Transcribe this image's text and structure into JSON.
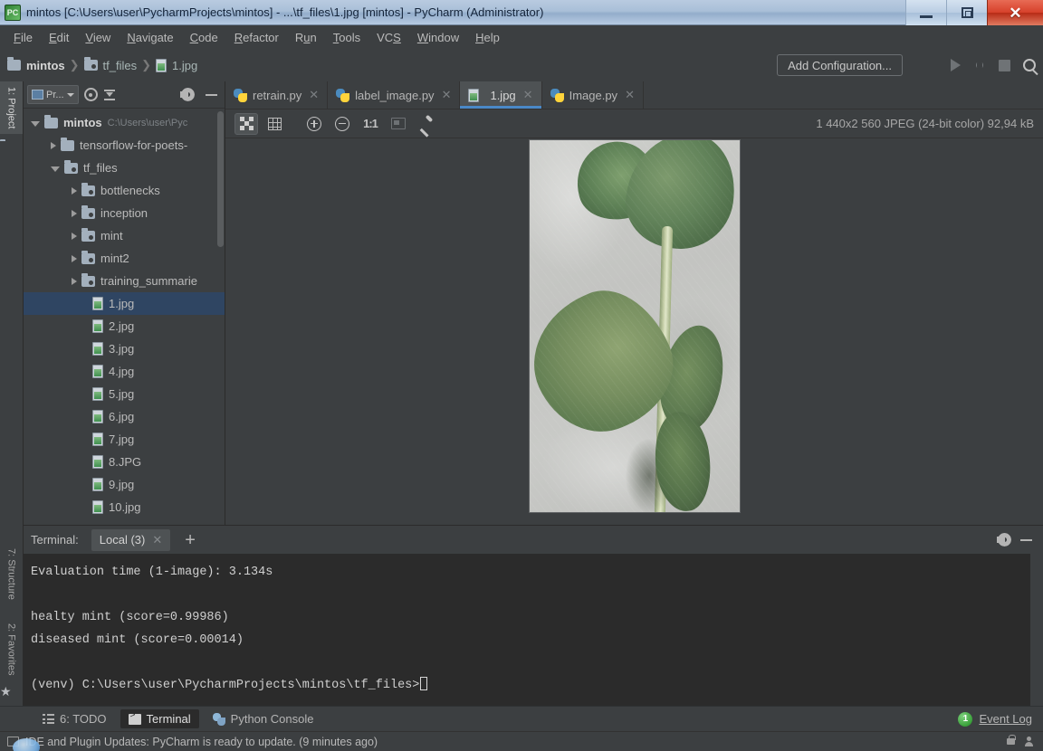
{
  "window": {
    "title": "mintos [C:\\Users\\user\\PycharmProjects\\mintos] - ...\\tf_files\\1.jpg [mintos] - PyCharm (Administrator)",
    "app_icon": "pycharm-icon",
    "controls": {
      "minimize": "minimize-icon",
      "maximize": "restore-icon",
      "close": "✕"
    }
  },
  "menubar": {
    "items": [
      {
        "label": "File"
      },
      {
        "label": "Edit"
      },
      {
        "label": "View"
      },
      {
        "label": "Navigate"
      },
      {
        "label": "Code"
      },
      {
        "label": "Refactor"
      },
      {
        "label": "Run"
      },
      {
        "label": "Tools"
      },
      {
        "label": "VCS"
      },
      {
        "label": "Window"
      },
      {
        "label": "Help"
      }
    ]
  },
  "navbar": {
    "breadcrumbs": [
      {
        "label": "mintos",
        "icon": "folder-icon"
      },
      {
        "label": "tf_files",
        "icon": "source-folder-icon"
      },
      {
        "label": "1.jpg",
        "icon": "jpg-file-icon"
      }
    ],
    "separator": "❯",
    "add_configuration": "Add Configuration...",
    "run_icon": "run-icon",
    "debug_icon": "debug-icon",
    "stop_icon": "stop-icon",
    "search_icon": "search-icon"
  },
  "stripe": {
    "top": [
      {
        "label": "1: Project",
        "icon": "project-folder-icon",
        "active": true
      }
    ],
    "bottom": [
      {
        "label": "7: Structure",
        "icon": "structure-icon"
      },
      {
        "label": "2: Favorites",
        "icon": "star-icon"
      }
    ]
  },
  "project_panel": {
    "combo_label": "Pr...",
    "buttons": {
      "select_target": "target-icon",
      "collapse_all": "collapse-all-icon",
      "settings": "gear-icon",
      "hide": "minimize-icon"
    },
    "tree": [
      {
        "label": "mintos",
        "path": "C:\\Users\\user\\Pyc",
        "indent": 0,
        "state": "open",
        "icon": "folder-icon",
        "bold": true
      },
      {
        "label": "tensorflow-for-poets-",
        "path": "",
        "indent": 1,
        "state": "closed",
        "icon": "folder-icon",
        "bold": false
      },
      {
        "label": "tf_files",
        "path": "",
        "indent": 1,
        "state": "open",
        "icon": "source-folder-icon",
        "bold": false
      },
      {
        "label": "bottlenecks",
        "path": "",
        "indent": 2,
        "state": "closed",
        "icon": "source-folder-icon",
        "bold": false
      },
      {
        "label": "inception",
        "path": "",
        "indent": 2,
        "state": "closed",
        "icon": "source-folder-icon",
        "bold": false
      },
      {
        "label": "mint",
        "path": "",
        "indent": 2,
        "state": "closed",
        "icon": "source-folder-icon",
        "bold": false
      },
      {
        "label": "mint2",
        "path": "",
        "indent": 2,
        "state": "closed",
        "icon": "source-folder-icon",
        "bold": false
      },
      {
        "label": "training_summarie",
        "path": "",
        "indent": 2,
        "state": "closed",
        "icon": "source-folder-icon",
        "bold": false
      },
      {
        "label": "1.jpg",
        "path": "",
        "indent": 3,
        "state": "leaf",
        "icon": "jpg-file-icon",
        "selected": true
      },
      {
        "label": "2.jpg",
        "path": "",
        "indent": 3,
        "state": "leaf",
        "icon": "jpg-file-icon"
      },
      {
        "label": "3.jpg",
        "path": "",
        "indent": 3,
        "state": "leaf",
        "icon": "jpg-file-icon"
      },
      {
        "label": "4.jpg",
        "path": "",
        "indent": 3,
        "state": "leaf",
        "icon": "jpg-file-icon"
      },
      {
        "label": "5.jpg",
        "path": "",
        "indent": 3,
        "state": "leaf",
        "icon": "jpg-file-icon"
      },
      {
        "label": "6.jpg",
        "path": "",
        "indent": 3,
        "state": "leaf",
        "icon": "jpg-file-icon"
      },
      {
        "label": "7.jpg",
        "path": "",
        "indent": 3,
        "state": "leaf",
        "icon": "jpg-file-icon"
      },
      {
        "label": "8.JPG",
        "path": "",
        "indent": 3,
        "state": "leaf",
        "icon": "jpg-file-icon"
      },
      {
        "label": "9.jpg",
        "path": "",
        "indent": 3,
        "state": "leaf",
        "icon": "jpg-file-icon"
      },
      {
        "label": "10.jpg",
        "path": "",
        "indent": 3,
        "state": "leaf",
        "icon": "jpg-file-icon"
      }
    ]
  },
  "editor": {
    "tabs": [
      {
        "label": "retrain.py",
        "icon": "python-file-icon",
        "active": false,
        "close": "✕"
      },
      {
        "label": "label_image.py",
        "icon": "python-file-icon",
        "active": false,
        "close": "✕"
      },
      {
        "label": "1.jpg",
        "icon": "jpg-file-icon",
        "active": true,
        "close": "✕"
      },
      {
        "label": "Image.py",
        "icon": "python-file-icon",
        "active": false,
        "close": "✕"
      }
    ],
    "image_toolbar": {
      "toggle_transparency": "checkerboard-icon",
      "toggle_grid": "pixel-grid-icon",
      "zoom_in": "zoom-in-icon",
      "zoom_out": "zoom-out-icon",
      "actual_size": "1:1",
      "fit_to_window": "fit-to-window-icon",
      "color_picker": "color-picker-icon"
    },
    "image_info": "1 440x2 560 JPEG (24-bit color) 92,94 kB",
    "image_alt": "mint-plant-photo"
  },
  "terminal": {
    "label": "Terminal:",
    "tab": {
      "label": "Local (3)",
      "close": "✕"
    },
    "new_tab": "+",
    "settings_icon": "gear-icon",
    "hide_icon": "minimize-icon",
    "lines": [
      "Evaluation time (1-image): 3.134s",
      "",
      "healty mint (score=0.99986)",
      "diseased mint (score=0.00014)",
      ""
    ],
    "prompt": "(venv) C:\\Users\\user\\PycharmProjects\\mintos\\tf_files>"
  },
  "statusbar": {
    "items": [
      {
        "label": "6: TODO",
        "icon": "todo-icon",
        "active": false
      },
      {
        "label": "Terminal",
        "icon": "terminal-icon",
        "active": true
      },
      {
        "label": "Python Console",
        "icon": "python-console-icon",
        "active": false
      }
    ],
    "event_log": {
      "label": "Event Log",
      "count": "1"
    }
  },
  "notification": {
    "icon": "ide-update-icon",
    "text": "IDE and Plugin Updates: PyCharm is ready to update. (9 minutes ago)",
    "right_icons": [
      "lock-icon",
      "person-icon"
    ]
  },
  "colors": {
    "accent": "#4a88c7",
    "panel_bg": "#3c3f41",
    "editor_bg": "#2b2b2b",
    "selection": "#2f4562",
    "badge_green": "#3aa13a"
  }
}
